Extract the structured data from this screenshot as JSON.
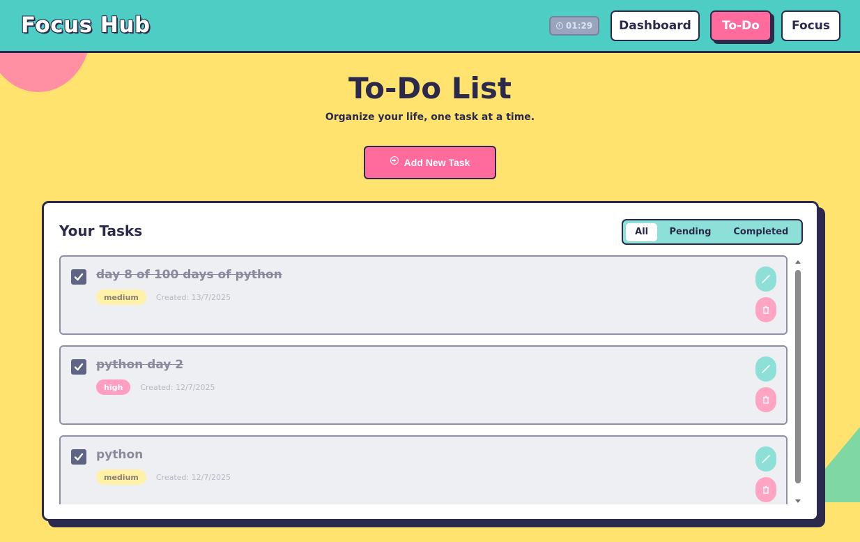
{
  "brand": "Focus Hub",
  "timer": "01:29",
  "nav": {
    "dashboard": "Dashboard",
    "todo": "To-Do",
    "focus": "Focus"
  },
  "hero": {
    "title": "To-Do List",
    "subtitle": "Organize your life, one task at a time.",
    "add_button": "Add New Task"
  },
  "panel": {
    "title": "Your Tasks",
    "filters": [
      "All",
      "Pending",
      "Completed"
    ],
    "active_filter": "All"
  },
  "tasks": [
    {
      "title": "day 8 of 100 days of python",
      "priority": "medium",
      "created": "Created: 13/7/2025",
      "completed": true
    },
    {
      "title": "python day 2",
      "priority": "high",
      "created": "Created: 12/7/2025",
      "completed": true
    },
    {
      "title": "python",
      "priority": "medium",
      "created": "Created: 12/7/2025",
      "completed": true
    }
  ],
  "colors": {
    "background": "#FFE36E",
    "header": "#4ECDC4",
    "accent_pink": "#FF6B9D",
    "ink": "#2b2a4c",
    "mint": "#8DE0D8"
  },
  "icons": {
    "timer": "clock-icon",
    "add": "plus-circle-icon",
    "check": "check-icon",
    "edit": "pencil-icon",
    "delete": "trash-icon"
  }
}
